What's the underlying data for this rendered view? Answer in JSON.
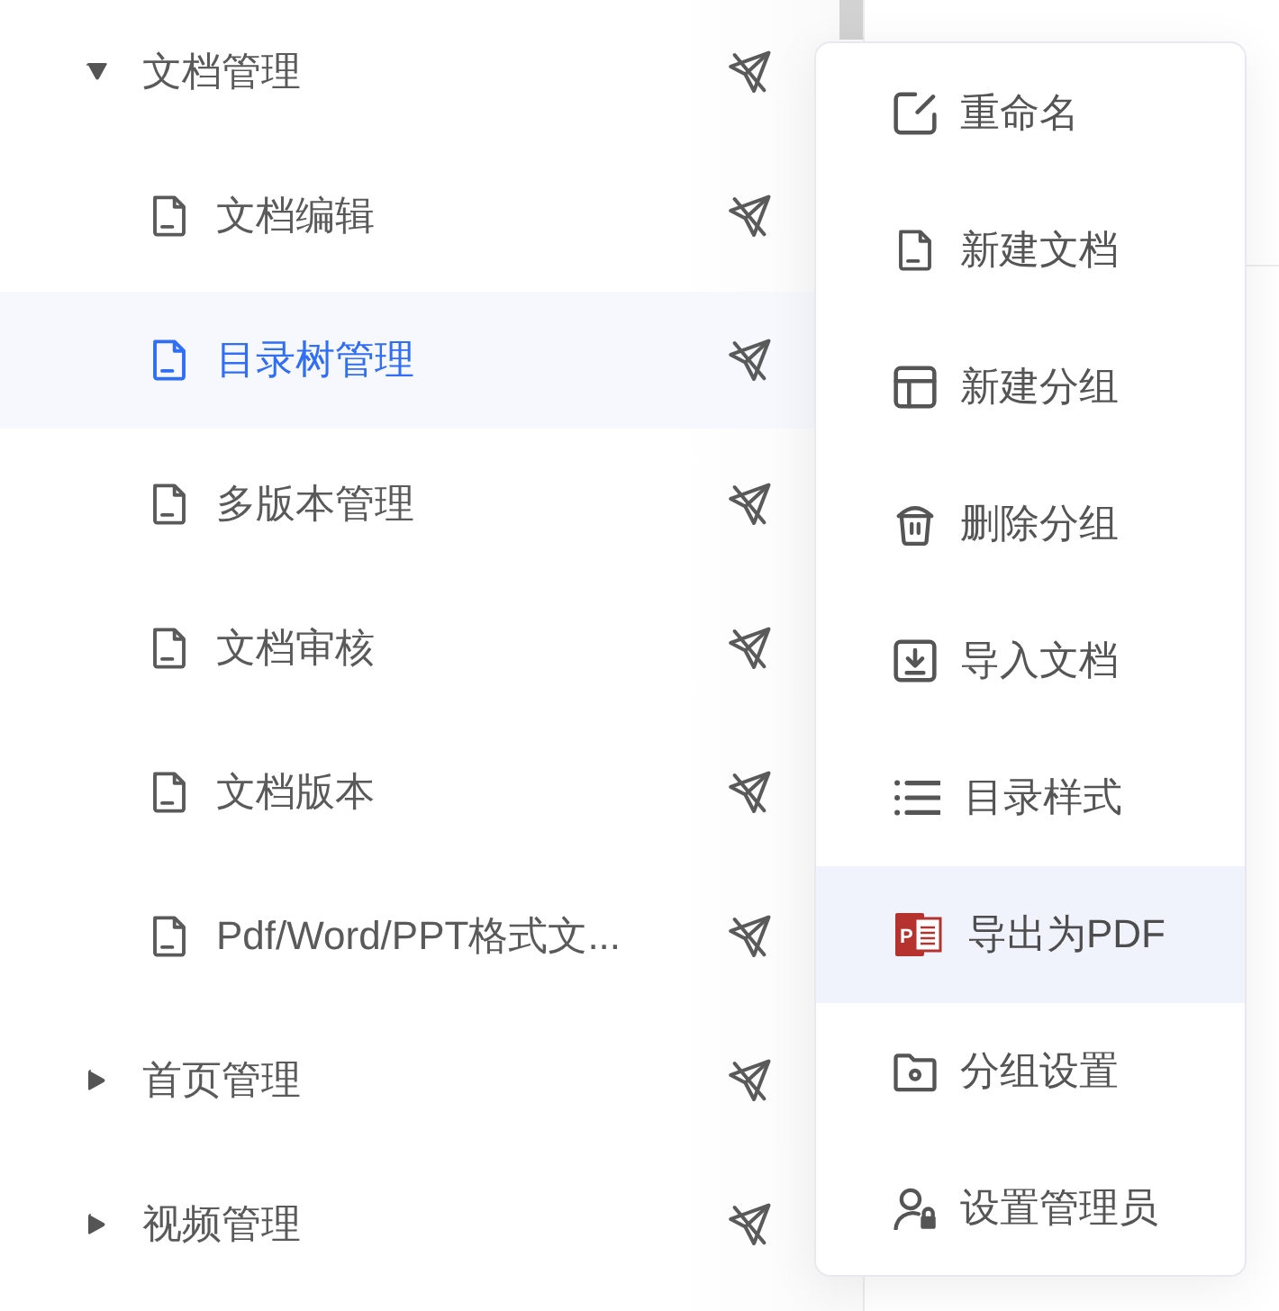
{
  "tree": [
    {
      "kind": "group",
      "label": "文档管理",
      "expanded": true,
      "selected": false,
      "children": [
        {
          "kind": "doc",
          "label": "文档编辑",
          "selected": false
        },
        {
          "kind": "doc",
          "label": "目录树管理",
          "selected": true
        },
        {
          "kind": "doc",
          "label": "多版本管理",
          "selected": false
        },
        {
          "kind": "doc",
          "label": "文档审核",
          "selected": false
        },
        {
          "kind": "doc",
          "label": "文档版本",
          "selected": false
        },
        {
          "kind": "doc",
          "label": "Pdf/Word/PPT格式文...",
          "selected": false
        }
      ]
    },
    {
      "kind": "group",
      "label": "首页管理",
      "expanded": false,
      "selected": false
    },
    {
      "kind": "group",
      "label": "视频管理",
      "expanded": false,
      "selected": false
    }
  ],
  "context_menu": {
    "items": [
      {
        "label": "重命名",
        "selected": false
      },
      {
        "label": "新建文档",
        "selected": false
      },
      {
        "label": "新建分组",
        "selected": false
      },
      {
        "label": "删除分组",
        "selected": false
      },
      {
        "label": "导入文档",
        "selected": false
      },
      {
        "label": "目录样式",
        "selected": false
      },
      {
        "label": "导出为PDF",
        "selected": true,
        "icon_letter": "P"
      },
      {
        "label": "分组设置",
        "selected": false
      },
      {
        "label": "设置管理员",
        "selected": false
      }
    ]
  }
}
